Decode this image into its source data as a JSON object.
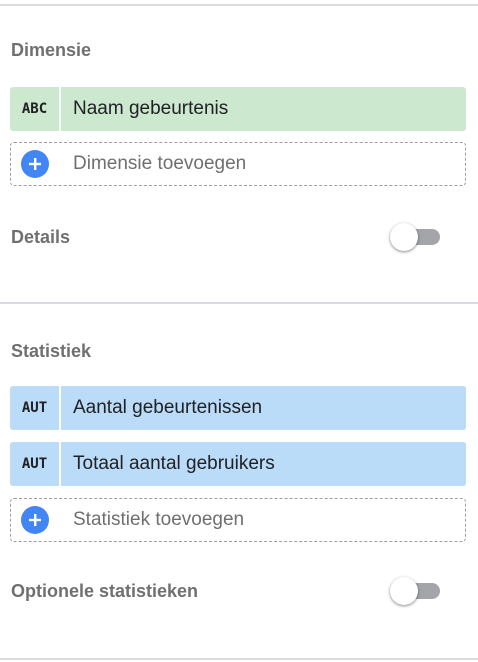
{
  "dimension": {
    "title": "Dimensie",
    "items": [
      {
        "tag": "ABC",
        "label": "Naam gebeurtenis"
      }
    ],
    "add_label": "Dimensie toevoegen"
  },
  "details": {
    "label": "Details",
    "enabled": false
  },
  "metric": {
    "title": "Statistiek",
    "items": [
      {
        "tag": "AUT",
        "label": "Aantal gebeurtenissen"
      },
      {
        "tag": "AUT",
        "label": "Totaal aantal gebruikers"
      }
    ],
    "add_label": "Statistiek toevoegen"
  },
  "optional_metrics": {
    "label": "Optionele statistieken",
    "enabled": false
  },
  "colors": {
    "dimension_chip": "#cce8cf",
    "metric_chip": "#bbdcf8",
    "add_button": "#4285f4",
    "toggle_track_off": "#a3a5a8"
  },
  "icons": {
    "add": "plus-icon"
  }
}
